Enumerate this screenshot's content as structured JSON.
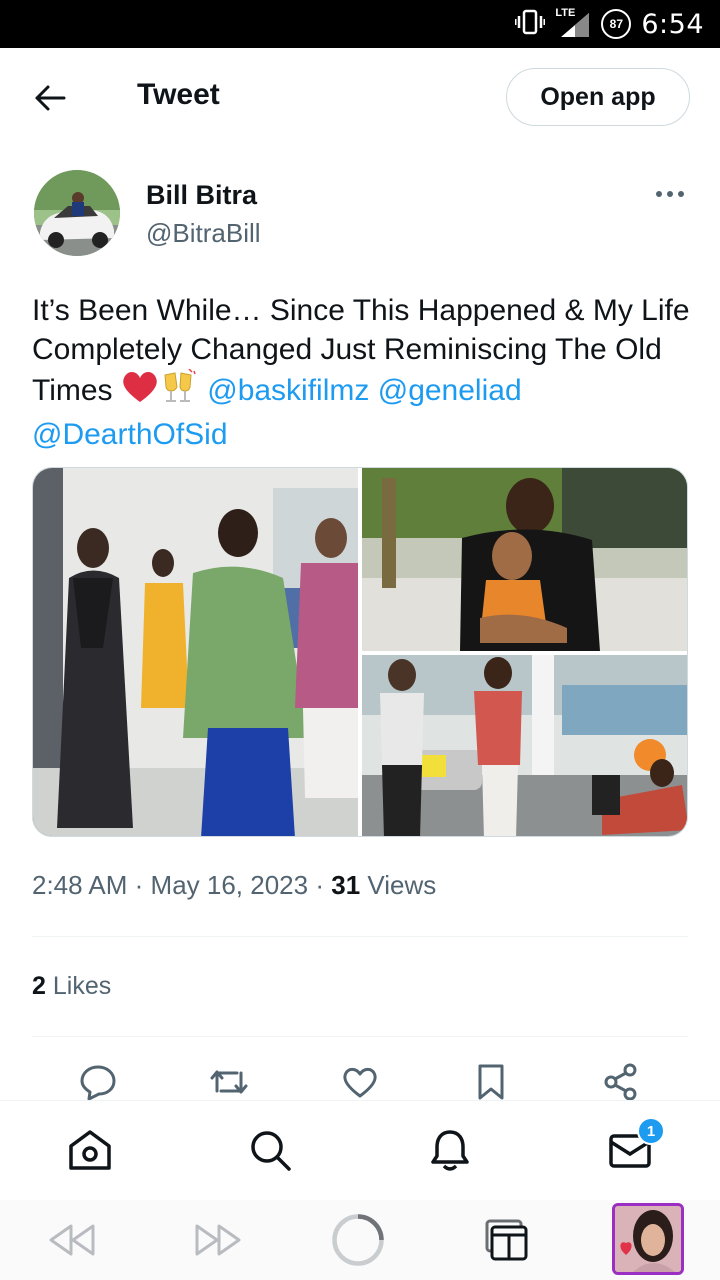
{
  "status_bar": {
    "network": "LTE",
    "battery": "87",
    "time": "6:54"
  },
  "header": {
    "title": "Tweet",
    "open_app_label": "Open app"
  },
  "author": {
    "name": "Bill Bitra",
    "handle": "@BitraBill"
  },
  "tweet": {
    "text_part1": "It’s Been While… Since This Happened & My Life Completely Changed Just Reminiscing The Old Times ",
    "mentions": [
      "@baskifilmz",
      "@geneliad",
      "@DearthOfSid"
    ],
    "emojis": [
      "red-heart",
      "clinking-glasses"
    ]
  },
  "meta": {
    "time": "2:48 AM",
    "separator": "·",
    "date": "May 16, 2023",
    "views_count": "31",
    "views_label": "Views"
  },
  "likes": {
    "count": "2",
    "label": "Likes"
  },
  "actions": [
    "reply-icon",
    "retweet-icon",
    "like-icon",
    "bookmark-icon",
    "share-icon"
  ],
  "bottom_nav": {
    "items": [
      "home-icon",
      "search-icon",
      "notifications-icon",
      "messages-icon"
    ],
    "messages_badge": "1"
  },
  "browser_bar": {
    "items": [
      "back-icon",
      "forward-icon",
      "reload-icon",
      "tabs-icon"
    ]
  },
  "colors": {
    "link": "#1d9bf0",
    "secondary_text": "#536471",
    "primary_text": "#0f1419",
    "divider": "#eff3f4",
    "badge": "#1d9bf0"
  }
}
